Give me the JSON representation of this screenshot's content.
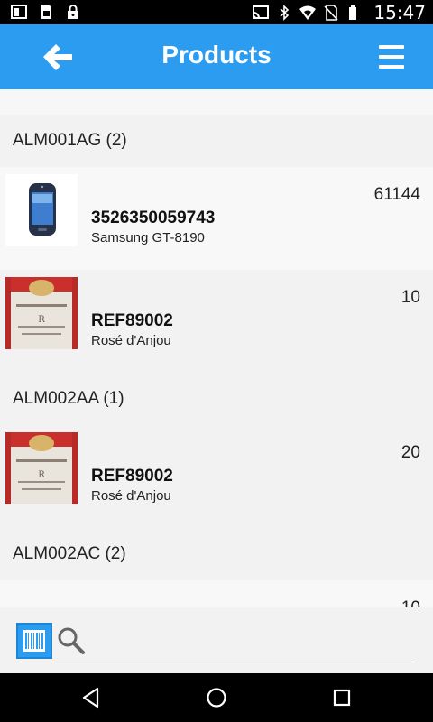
{
  "status_bar": {
    "time": "15:47",
    "icons_left": [
      "recent-apps-icon",
      "sim-icon",
      "lock-icon"
    ],
    "icons_right": [
      "cast-icon",
      "bluetooth-icon",
      "wifi-icon",
      "no-sim-icon",
      "battery-icon"
    ]
  },
  "app_bar": {
    "title": "Products",
    "back_icon": "back-arrow-icon",
    "menu_icon": "hamburger-menu-icon"
  },
  "groups": [
    {
      "header": "ALM001AG (2)",
      "items": [
        {
          "code": "3526350059743",
          "name": "Samsung GT-8190",
          "qty": "61144",
          "thumb": "phone"
        },
        {
          "code": "REF89002",
          "name": "Rosé d'Anjou",
          "qty": "10",
          "thumb": "wine-label"
        }
      ]
    },
    {
      "header": "ALM002AA (1)",
      "items": [
        {
          "code": "REF89002",
          "name": "Rosé d'Anjou",
          "qty": "20",
          "thumb": "wine-label"
        }
      ]
    },
    {
      "header": "ALM002AC (2)",
      "items": [
        {
          "qty": "10"
        }
      ]
    }
  ],
  "search": {
    "placeholder": "",
    "value": ""
  },
  "colors": {
    "accent": "#2b9cef",
    "background": "#f2f2f2"
  }
}
